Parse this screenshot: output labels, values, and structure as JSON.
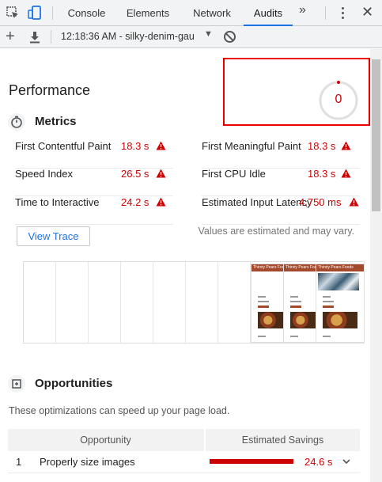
{
  "tabs": [
    {
      "label": "Console",
      "active": false
    },
    {
      "label": "Elements",
      "active": false
    },
    {
      "label": "Network",
      "active": false
    },
    {
      "label": "Audits",
      "active": true
    }
  ],
  "tab_overflow": "»",
  "toolbar": {
    "run_label": "12:18:36 AM - silky-denim-gau"
  },
  "performance": {
    "title": "Performance",
    "score": "0",
    "score_color": "#cc0000"
  },
  "metrics": {
    "title": "Metrics",
    "items": [
      {
        "label": "First Contentful Paint",
        "value": "18.3 s"
      },
      {
        "label": "First Meaningful Paint",
        "value": "18.3 s"
      },
      {
        "label": "Speed Index",
        "value": "26.5 s"
      },
      {
        "label": "First CPU Idle",
        "value": "18.3 s"
      },
      {
        "label": "Time to Interactive",
        "value": "24.2 s"
      },
      {
        "label": "Estimated Input Latency",
        "value": "4,750 ms"
      }
    ],
    "view_trace_label": "View Trace",
    "disclaimer": "Values are estimated and may vary."
  },
  "filmstrip": {
    "thumb_header": "Thirsty Pears  Foods"
  },
  "opportunities": {
    "title": "Opportunities",
    "description": "These optimizations can speed up your page load.",
    "col_opportunity": "Opportunity",
    "col_savings": "Estimated Savings",
    "rows": [
      {
        "index": "1",
        "name": "Properly size images",
        "savings": "24.6 s"
      }
    ]
  },
  "colors": {
    "fail": "#cc0000",
    "accent": "#1a73e8"
  }
}
